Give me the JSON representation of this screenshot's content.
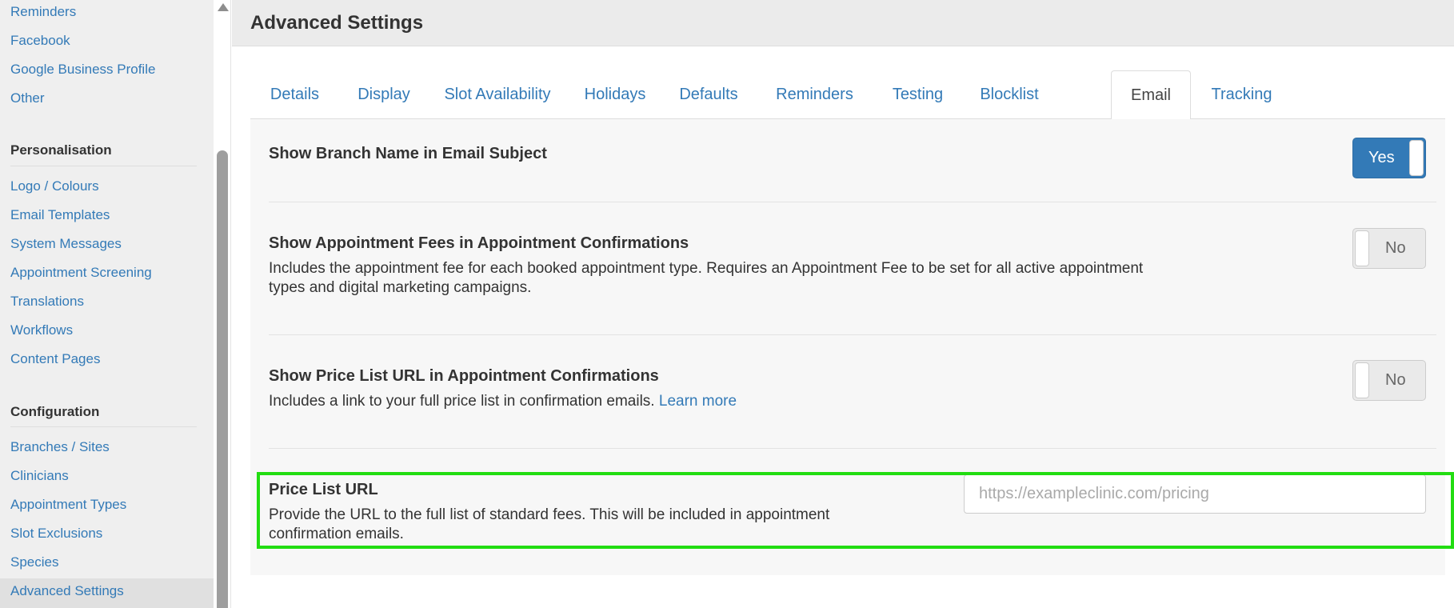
{
  "sidebar": {
    "top_items": [
      {
        "label": "Reminders"
      },
      {
        "label": "Facebook"
      },
      {
        "label": "Google Business Profile"
      },
      {
        "label": "Other"
      }
    ],
    "personalisation": {
      "heading": "Personalisation",
      "items": [
        {
          "label": "Logo / Colours"
        },
        {
          "label": "Email Templates"
        },
        {
          "label": "System Messages"
        },
        {
          "label": "Appointment Screening"
        },
        {
          "label": "Translations"
        },
        {
          "label": "Workflows"
        },
        {
          "label": "Content Pages"
        }
      ]
    },
    "configuration": {
      "heading": "Configuration",
      "items": [
        {
          "label": "Branches / Sites"
        },
        {
          "label": "Clinicians"
        },
        {
          "label": "Appointment Types"
        },
        {
          "label": "Slot Exclusions"
        },
        {
          "label": "Species"
        },
        {
          "label": "Advanced Settings",
          "active": true
        }
      ]
    }
  },
  "header": {
    "title": "Advanced Settings"
  },
  "tabs": [
    {
      "label": "Details"
    },
    {
      "label": "Display"
    },
    {
      "label": "Slot Availability"
    },
    {
      "label": "Holidays"
    },
    {
      "label": "Defaults"
    },
    {
      "label": "Reminders"
    },
    {
      "label": "Testing"
    },
    {
      "label": "Blocklist"
    },
    {
      "label": "Email",
      "active": true
    },
    {
      "label": "Tracking"
    }
  ],
  "settings": {
    "branch_name": {
      "title": "Show Branch Name in Email Subject",
      "toggle": "Yes"
    },
    "appointment_fees": {
      "title": "Show Appointment Fees in Appointment Confirmations",
      "description": "Includes the appointment fee for each booked appointment type. Requires an Appointment Fee to be set for all active appointment types and digital marketing campaigns.",
      "toggle": "No"
    },
    "price_list_url_toggle": {
      "title": "Show Price List URL in Appointment Confirmations",
      "description": "Includes a link to your full price list in confirmation emails.",
      "link": "Learn more",
      "toggle": "No"
    },
    "price_list_url": {
      "title": "Price List URL",
      "description": "Provide the URL to the full list of standard fees. This will be included in appointment confirmation emails.",
      "value": "",
      "placeholder": "https://exampleclinic.com/pricing"
    }
  },
  "colors": {
    "link": "#337ab7",
    "toggle_on": "#337ab7",
    "highlight": "#22dd11"
  }
}
